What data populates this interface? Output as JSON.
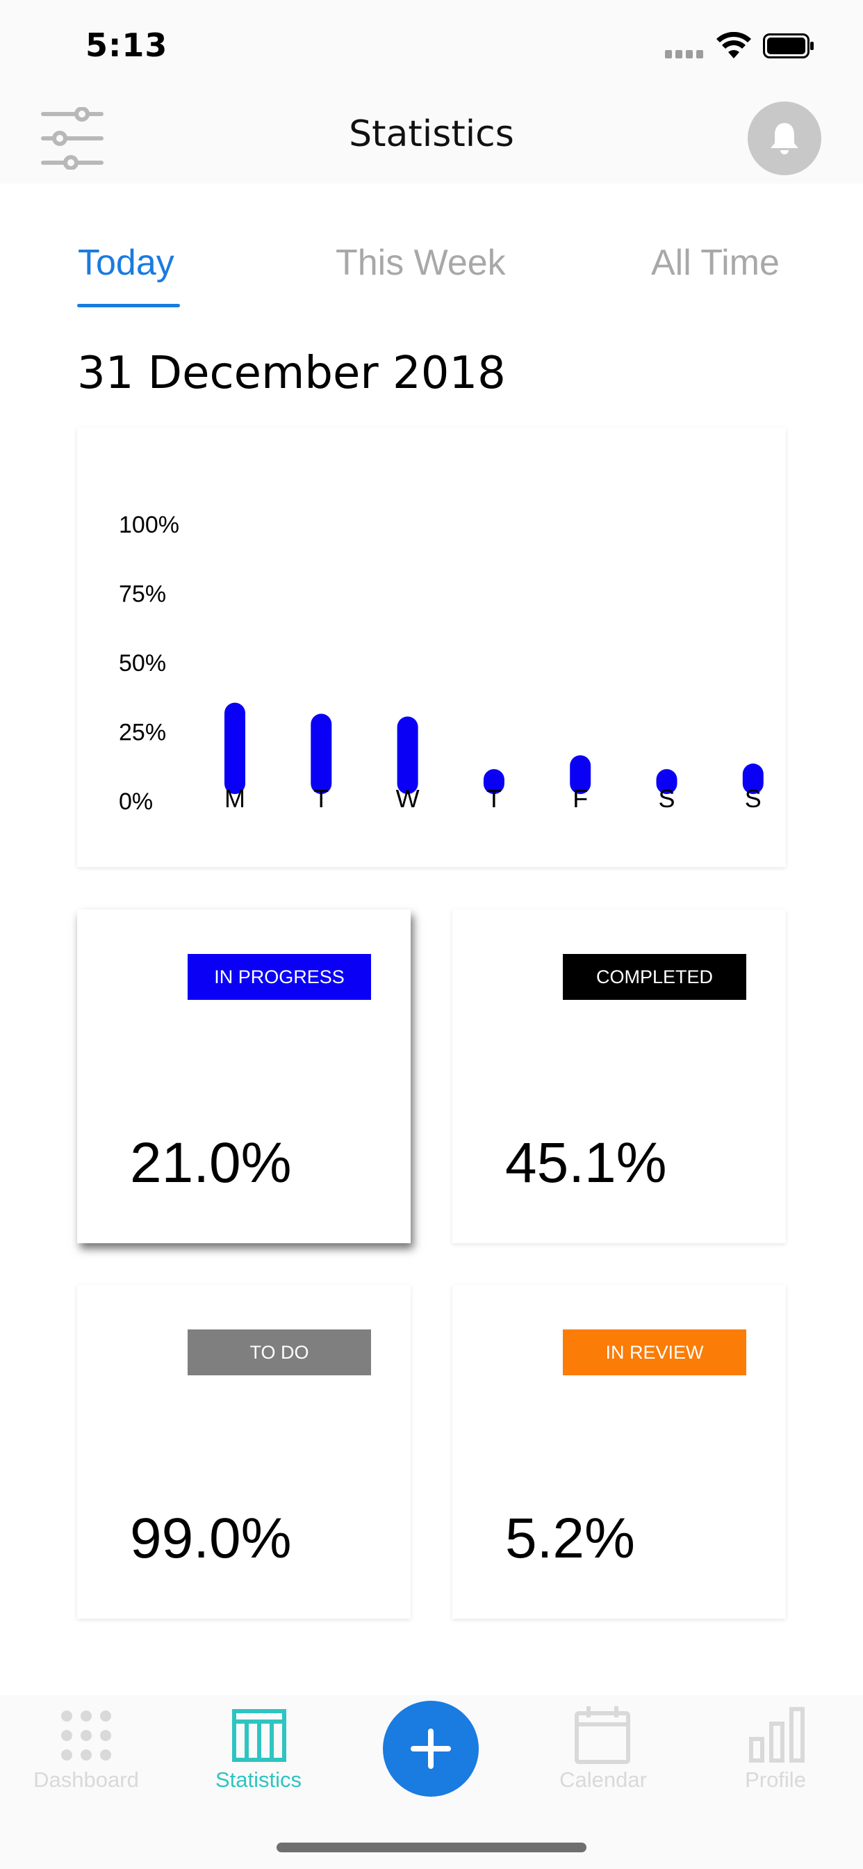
{
  "status_bar": {
    "time": "5:13"
  },
  "header": {
    "title": "Statistics"
  },
  "tabs": [
    {
      "label": "Today",
      "active": true
    },
    {
      "label": "This Week",
      "active": false
    },
    {
      "label": "All Time",
      "active": false
    }
  ],
  "date_label": "31 December 2018",
  "chart_data": {
    "type": "bar",
    "categories": [
      "M",
      "T",
      "W",
      "T",
      "F",
      "S",
      "S"
    ],
    "values": [
      31,
      27,
      26,
      7,
      12,
      7,
      9
    ],
    "y_ticks": [
      "0%",
      "25%",
      "50%",
      "75%",
      "100%"
    ],
    "ylim": [
      0,
      100
    ],
    "bar_color": "#0a00f5",
    "grid": false
  },
  "stats": [
    {
      "label": "IN PROGRESS",
      "value": "21.0%",
      "color": "#0a00f5",
      "selected": true
    },
    {
      "label": "COMPLETED",
      "value": "45.1%",
      "color": "#000000",
      "selected": false
    },
    {
      "label": "TO DO",
      "value": "99.0%",
      "color": "#7f7f7f",
      "selected": false
    },
    {
      "label": "IN REVIEW",
      "value": "5.2%",
      "color": "#fb7c06",
      "selected": false
    }
  ],
  "bottom_nav": {
    "items": [
      {
        "label": "Dashboard",
        "icon": "grid-icon",
        "active": false
      },
      {
        "label": "Statistics",
        "icon": "table-icon",
        "active": true
      },
      {
        "label": "Calendar",
        "icon": "calendar-icon",
        "active": false
      },
      {
        "label": "Profile",
        "icon": "bar-chart-icon",
        "active": false
      }
    ],
    "fab_icon": "plus-icon"
  },
  "colors": {
    "accent": "#1a7be0",
    "active_nav": "#2ec4c1",
    "inactive_nav": "#d9d9d9",
    "inactive_tab": "#a8a8a8"
  }
}
